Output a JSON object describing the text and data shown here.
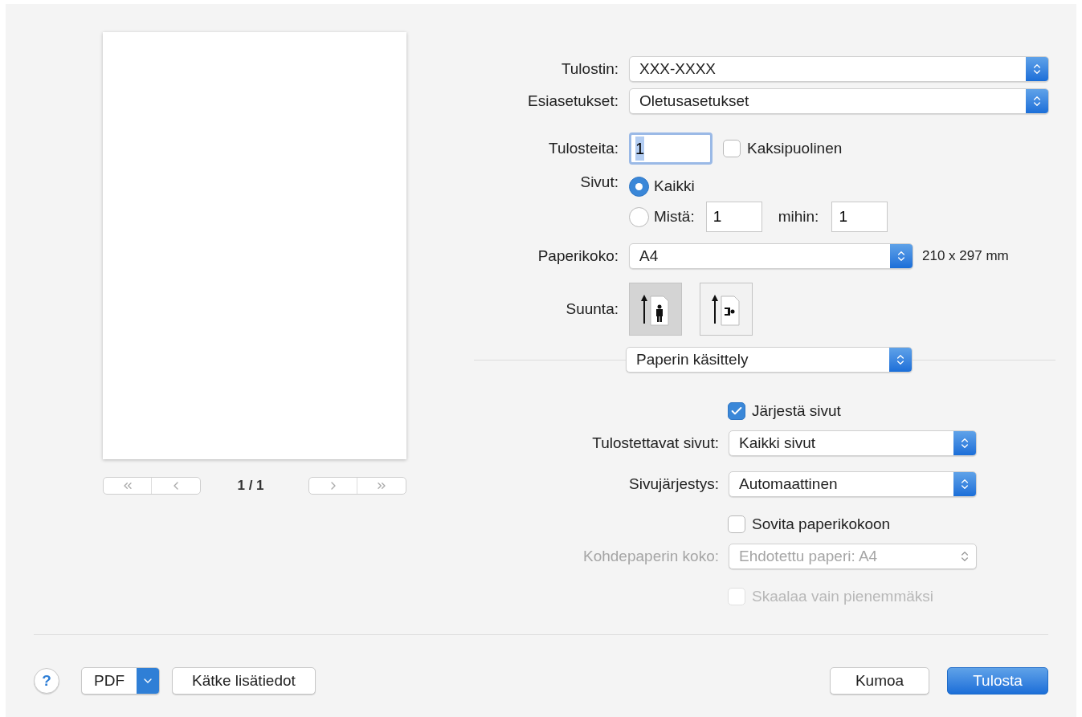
{
  "preview": {
    "page_indicator": "1 / 1"
  },
  "printer": {
    "label": "Tulostin:",
    "value": "XXX-XXXX"
  },
  "presets": {
    "label": "Esiasetukset:",
    "value": "Oletusasetukset"
  },
  "copies": {
    "label": "Tulosteita:",
    "value": "1",
    "focused": true
  },
  "duplex": {
    "label": "Kaksipuolinen",
    "checked": false
  },
  "pages": {
    "label": "Sivut:",
    "options": [
      {
        "kind": "all",
        "label": "Kaikki",
        "selected": true
      },
      {
        "kind": "range",
        "label": "Mistä:",
        "selected": false,
        "from": "1",
        "to_label": "mihin:",
        "to": "1"
      }
    ]
  },
  "paper_size": {
    "label": "Paperikoko:",
    "value": "A4",
    "dimensions": "210 x 297 mm"
  },
  "orientation": {
    "label": "Suunta:",
    "options": [
      {
        "kind": "portrait",
        "selected": true
      },
      {
        "kind": "landscape",
        "selected": false
      }
    ]
  },
  "section_popup": {
    "value": "Paperin käsittely"
  },
  "paper_handling": [
    {
      "kind": "checkbox",
      "label": "Järjestä sivut",
      "checked": true,
      "disabled": false
    },
    {
      "kind": "popup",
      "label": "Tulostettavat sivut:",
      "value": "Kaikki sivut",
      "disabled": false
    },
    {
      "kind": "popup",
      "label": "Sivujärjestys:",
      "value": "Automaattinen",
      "disabled": false
    },
    {
      "kind": "checkbox",
      "label": "Sovita paperikokoon",
      "checked": false,
      "disabled": false
    },
    {
      "kind": "popup",
      "label": "Kohdepaperin koko:",
      "value": "Ehdotettu paperi: A4",
      "disabled": true
    },
    {
      "kind": "checkbox",
      "label": "Skaalaa vain pienemmäksi",
      "checked": false,
      "disabled": true
    }
  ],
  "buttons": {
    "help": "?",
    "pdf": "PDF",
    "hide_details": "Kätke lisätiedot",
    "cancel": "Kumoa",
    "print": "Tulosta"
  }
}
